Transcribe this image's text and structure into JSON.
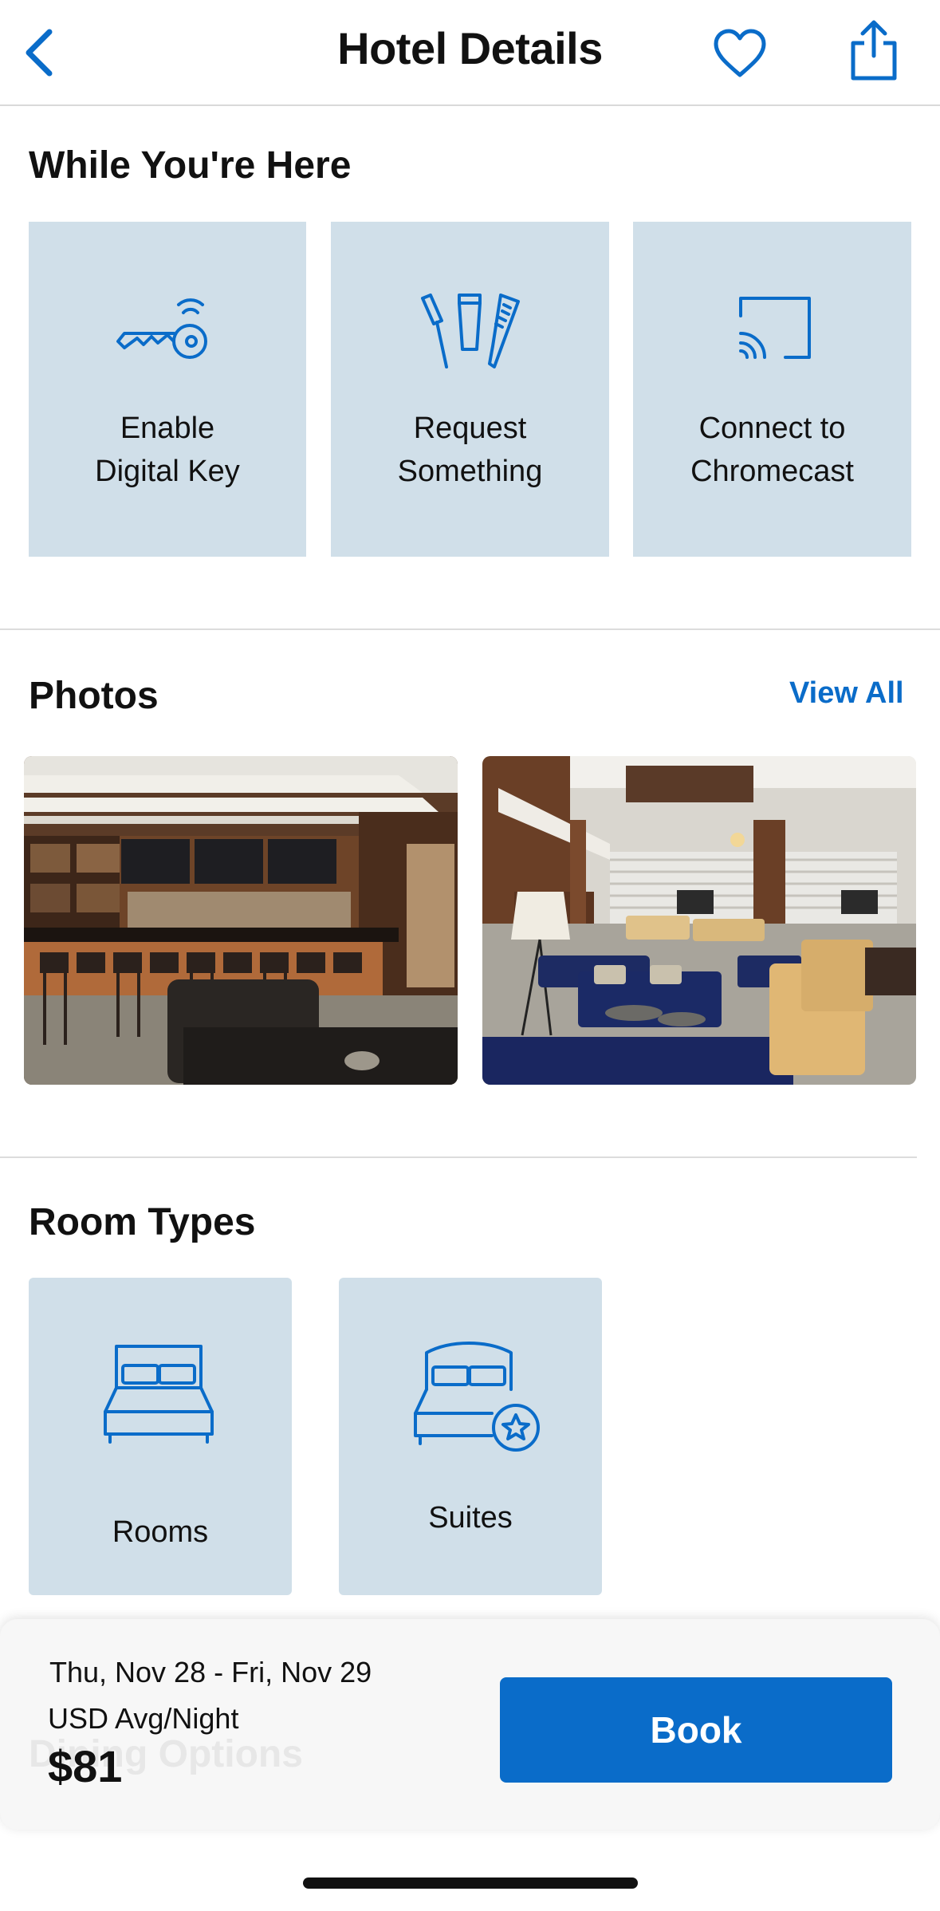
{
  "header": {
    "title": "Hotel Details"
  },
  "while_here": {
    "title": "While You're Here",
    "items": [
      {
        "label": "Enable\nDigital Key",
        "icon": "digital-key-icon"
      },
      {
        "label": "Request\nSomething",
        "icon": "amenities-icon"
      },
      {
        "label": "Connect to\nChromecast",
        "icon": "chromecast-icon"
      }
    ]
  },
  "photos": {
    "title": "Photos",
    "view_all": "View All",
    "items": [
      {
        "subject": "hotel bar with stools"
      },
      {
        "subject": "hotel lounge with blue sofas"
      }
    ]
  },
  "room_types": {
    "title": "Room Types",
    "items": [
      {
        "label": "Rooms",
        "icon": "bed-icon"
      },
      {
        "label": "Suites",
        "icon": "bed-star-icon"
      }
    ]
  },
  "booking": {
    "dates": "Thu, Nov 28 - Fri, Nov 29",
    "avg_label": "USD Avg/Night",
    "price": "$81",
    "book_label": "Book",
    "hidden_section_title": "Dining Options"
  },
  "colors": {
    "accent": "#0a6cc9",
    "tile_bg": "#d0dfe9"
  }
}
